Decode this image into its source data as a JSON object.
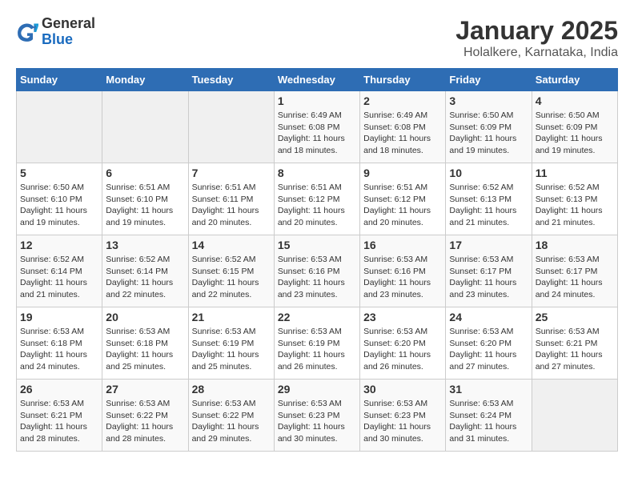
{
  "header": {
    "logo_line1": "General",
    "logo_line2": "Blue",
    "title": "January 2025",
    "subtitle": "Holalkere, Karnataka, India"
  },
  "days_of_week": [
    "Sunday",
    "Monday",
    "Tuesday",
    "Wednesday",
    "Thursday",
    "Friday",
    "Saturday"
  ],
  "weeks": [
    [
      {
        "num": "",
        "info": ""
      },
      {
        "num": "",
        "info": ""
      },
      {
        "num": "",
        "info": ""
      },
      {
        "num": "1",
        "info": "Sunrise: 6:49 AM\nSunset: 6:08 PM\nDaylight: 11 hours and 18 minutes."
      },
      {
        "num": "2",
        "info": "Sunrise: 6:49 AM\nSunset: 6:08 PM\nDaylight: 11 hours and 18 minutes."
      },
      {
        "num": "3",
        "info": "Sunrise: 6:50 AM\nSunset: 6:09 PM\nDaylight: 11 hours and 19 minutes."
      },
      {
        "num": "4",
        "info": "Sunrise: 6:50 AM\nSunset: 6:09 PM\nDaylight: 11 hours and 19 minutes."
      }
    ],
    [
      {
        "num": "5",
        "info": "Sunrise: 6:50 AM\nSunset: 6:10 PM\nDaylight: 11 hours and 19 minutes."
      },
      {
        "num": "6",
        "info": "Sunrise: 6:51 AM\nSunset: 6:10 PM\nDaylight: 11 hours and 19 minutes."
      },
      {
        "num": "7",
        "info": "Sunrise: 6:51 AM\nSunset: 6:11 PM\nDaylight: 11 hours and 20 minutes."
      },
      {
        "num": "8",
        "info": "Sunrise: 6:51 AM\nSunset: 6:12 PM\nDaylight: 11 hours and 20 minutes."
      },
      {
        "num": "9",
        "info": "Sunrise: 6:51 AM\nSunset: 6:12 PM\nDaylight: 11 hours and 20 minutes."
      },
      {
        "num": "10",
        "info": "Sunrise: 6:52 AM\nSunset: 6:13 PM\nDaylight: 11 hours and 21 minutes."
      },
      {
        "num": "11",
        "info": "Sunrise: 6:52 AM\nSunset: 6:13 PM\nDaylight: 11 hours and 21 minutes."
      }
    ],
    [
      {
        "num": "12",
        "info": "Sunrise: 6:52 AM\nSunset: 6:14 PM\nDaylight: 11 hours and 21 minutes."
      },
      {
        "num": "13",
        "info": "Sunrise: 6:52 AM\nSunset: 6:14 PM\nDaylight: 11 hours and 22 minutes."
      },
      {
        "num": "14",
        "info": "Sunrise: 6:52 AM\nSunset: 6:15 PM\nDaylight: 11 hours and 22 minutes."
      },
      {
        "num": "15",
        "info": "Sunrise: 6:53 AM\nSunset: 6:16 PM\nDaylight: 11 hours and 23 minutes."
      },
      {
        "num": "16",
        "info": "Sunrise: 6:53 AM\nSunset: 6:16 PM\nDaylight: 11 hours and 23 minutes."
      },
      {
        "num": "17",
        "info": "Sunrise: 6:53 AM\nSunset: 6:17 PM\nDaylight: 11 hours and 23 minutes."
      },
      {
        "num": "18",
        "info": "Sunrise: 6:53 AM\nSunset: 6:17 PM\nDaylight: 11 hours and 24 minutes."
      }
    ],
    [
      {
        "num": "19",
        "info": "Sunrise: 6:53 AM\nSunset: 6:18 PM\nDaylight: 11 hours and 24 minutes."
      },
      {
        "num": "20",
        "info": "Sunrise: 6:53 AM\nSunset: 6:18 PM\nDaylight: 11 hours and 25 minutes."
      },
      {
        "num": "21",
        "info": "Sunrise: 6:53 AM\nSunset: 6:19 PM\nDaylight: 11 hours and 25 minutes."
      },
      {
        "num": "22",
        "info": "Sunrise: 6:53 AM\nSunset: 6:19 PM\nDaylight: 11 hours and 26 minutes."
      },
      {
        "num": "23",
        "info": "Sunrise: 6:53 AM\nSunset: 6:20 PM\nDaylight: 11 hours and 26 minutes."
      },
      {
        "num": "24",
        "info": "Sunrise: 6:53 AM\nSunset: 6:20 PM\nDaylight: 11 hours and 27 minutes."
      },
      {
        "num": "25",
        "info": "Sunrise: 6:53 AM\nSunset: 6:21 PM\nDaylight: 11 hours and 27 minutes."
      }
    ],
    [
      {
        "num": "26",
        "info": "Sunrise: 6:53 AM\nSunset: 6:21 PM\nDaylight: 11 hours and 28 minutes."
      },
      {
        "num": "27",
        "info": "Sunrise: 6:53 AM\nSunset: 6:22 PM\nDaylight: 11 hours and 28 minutes."
      },
      {
        "num": "28",
        "info": "Sunrise: 6:53 AM\nSunset: 6:22 PM\nDaylight: 11 hours and 29 minutes."
      },
      {
        "num": "29",
        "info": "Sunrise: 6:53 AM\nSunset: 6:23 PM\nDaylight: 11 hours and 30 minutes."
      },
      {
        "num": "30",
        "info": "Sunrise: 6:53 AM\nSunset: 6:23 PM\nDaylight: 11 hours and 30 minutes."
      },
      {
        "num": "31",
        "info": "Sunrise: 6:53 AM\nSunset: 6:24 PM\nDaylight: 11 hours and 31 minutes."
      },
      {
        "num": "",
        "info": ""
      }
    ]
  ]
}
